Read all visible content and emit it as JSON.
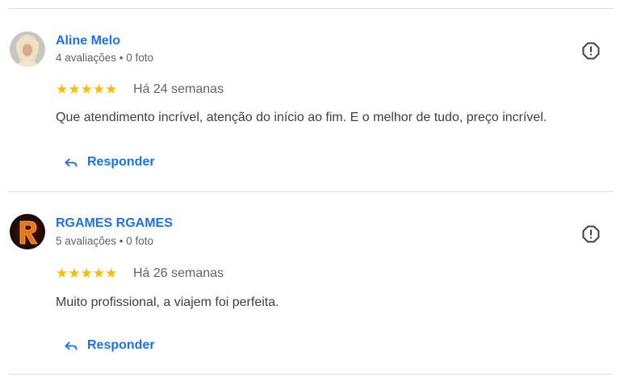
{
  "reviews": [
    {
      "name": "Aline Melo",
      "meta": "4 avaliações • 0 foto",
      "stars": "★★★★★",
      "rating": 5,
      "time": "Há 24 semanas",
      "text": "Que atendimento incrível, atenção do início ao fim. E o melhor de tudo, preço incrível.",
      "reply_label": "Responder"
    },
    {
      "name": "RGAMES RGAMES",
      "meta": "5 avaliações • 0 foto",
      "stars": "★★★★★",
      "rating": 5,
      "time": "Há 26 semanas",
      "text": "Muito profissional, a viajem foi perfeita.",
      "reply_label": "Responder"
    }
  ],
  "icons": {
    "report": "report-icon",
    "reply": "reply-arrow-icon",
    "star": "star-icon"
  },
  "colors": {
    "link": "#1a73e8",
    "star": "#fbbc04",
    "secondary_text": "#5f6368"
  }
}
